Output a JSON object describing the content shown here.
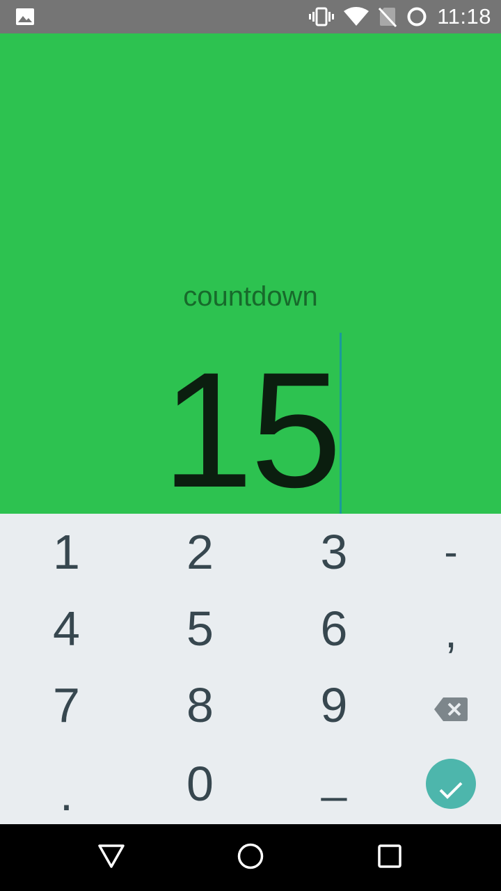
{
  "status_bar": {
    "time": "11:18",
    "icons": [
      "image-notification-icon",
      "vibrate-icon",
      "wifi-icon",
      "no-sim-icon",
      "battery-charging-icon"
    ]
  },
  "main": {
    "label": "countdown",
    "value": "15"
  },
  "keypad": {
    "rows": [
      [
        "1",
        "2",
        "3",
        "-"
      ],
      [
        "4",
        "5",
        "6",
        ","
      ],
      [
        "7",
        "8",
        "9",
        "backspace"
      ],
      [
        ".",
        "0",
        "_",
        "done"
      ]
    ],
    "labels": {
      "k1": "1",
      "k2": "2",
      "k3": "3",
      "minus": "-",
      "k4": "4",
      "k5": "5",
      "k6": "6",
      "comma": ",",
      "k7": "7",
      "k8": "8",
      "k9": "9",
      "dot": ".",
      "k0": "0",
      "underscore": "_"
    },
    "backspace_icon": "backspace-icon",
    "done_icon": "check-icon"
  },
  "nav_bar": {
    "buttons": [
      "back-icon",
      "home-icon",
      "recents-icon"
    ]
  },
  "colors": {
    "background": "#2dc250",
    "label": "#176a2b",
    "value": "#0b1e0f",
    "caret": "#1a9a9a",
    "keypad_bg": "#e9edf0",
    "key_text": "#37474f",
    "done_button": "#4db6ac",
    "status_bar": "#757575",
    "nav_bar": "#000000"
  }
}
